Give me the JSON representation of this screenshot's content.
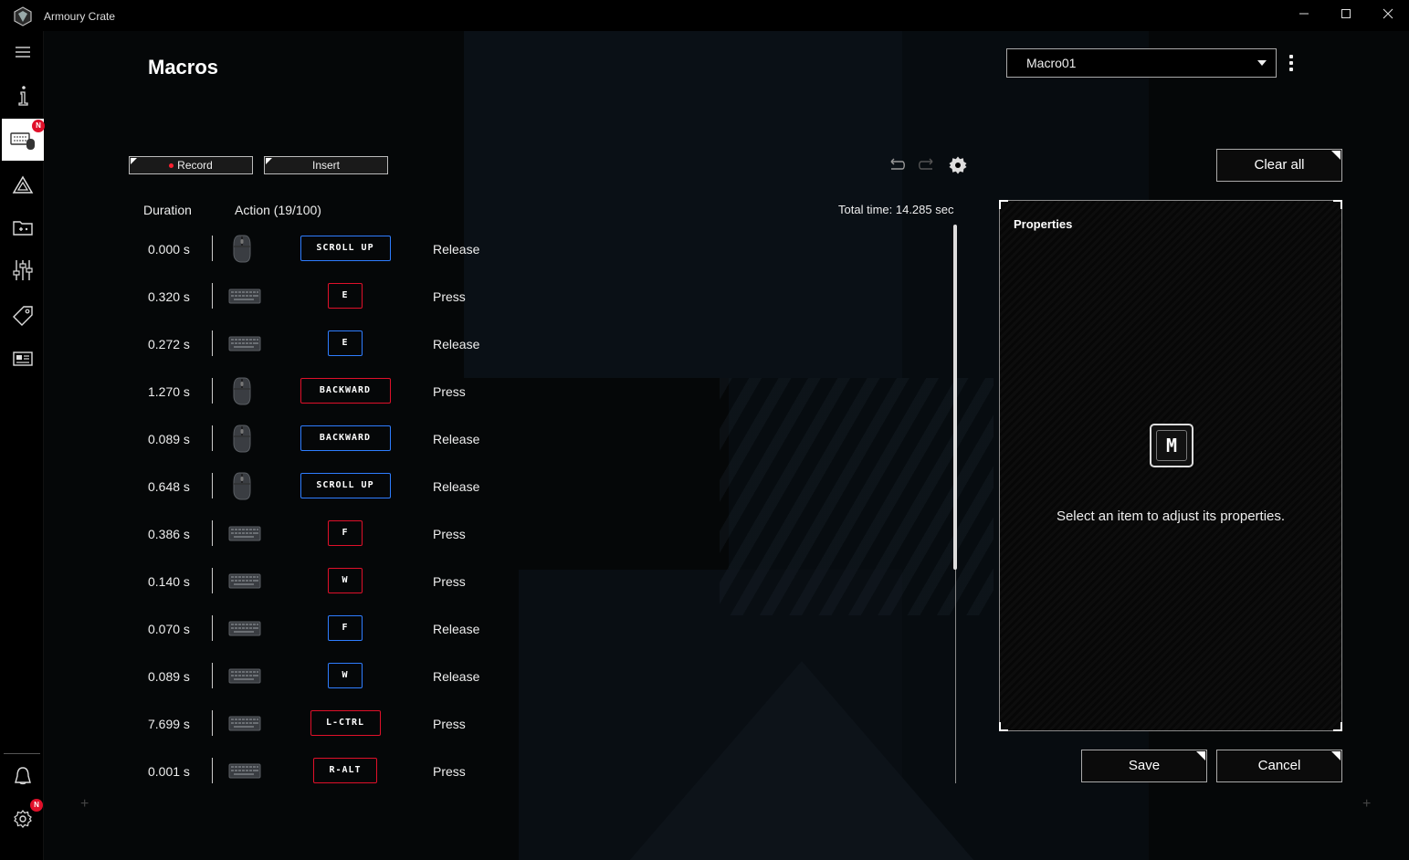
{
  "window": {
    "title": "Armoury Crate"
  },
  "page": {
    "title": "Macros"
  },
  "toolbar": {
    "record_label": "Record",
    "insert_label": "Insert",
    "clear_all_label": "Clear all"
  },
  "macro_select": {
    "value": "Macro01"
  },
  "table": {
    "duration_header": "Duration",
    "action_header": "Action (19/100)",
    "total_time": "Total time: 14.285 sec",
    "rows": [
      {
        "duration": "0.000 s",
        "device": "mouse",
        "key": "SCROLL UP",
        "event": "Release"
      },
      {
        "duration": "0.320 s",
        "device": "keyboard",
        "key": "E",
        "event": "Press"
      },
      {
        "duration": "0.272 s",
        "device": "keyboard",
        "key": "E",
        "event": "Release"
      },
      {
        "duration": "1.270 s",
        "device": "mouse",
        "key": "BACKWARD",
        "event": "Press"
      },
      {
        "duration": "0.089 s",
        "device": "mouse",
        "key": "BACKWARD",
        "event": "Release"
      },
      {
        "duration": "0.648 s",
        "device": "mouse",
        "key": "SCROLL UP",
        "event": "Release"
      },
      {
        "duration": "0.386 s",
        "device": "keyboard",
        "key": "F",
        "event": "Press"
      },
      {
        "duration": "0.140 s",
        "device": "keyboard",
        "key": "W",
        "event": "Press"
      },
      {
        "duration": "0.070 s",
        "device": "keyboard",
        "key": "F",
        "event": "Release"
      },
      {
        "duration": "0.089 s",
        "device": "keyboard",
        "key": "W",
        "event": "Release"
      },
      {
        "duration": "7.699 s",
        "device": "keyboard",
        "key": "L-CTRL",
        "event": "Press"
      },
      {
        "duration": "0.001 s",
        "device": "keyboard",
        "key": "R-ALT",
        "event": "Press"
      }
    ]
  },
  "properties": {
    "title": "Properties",
    "icon_letter": "M",
    "message": "Select an item to adjust its properties."
  },
  "actions": {
    "save_label": "Save",
    "cancel_label": "Cancel"
  },
  "sidebar": {
    "items": [
      {
        "name": "menu-icon"
      },
      {
        "name": "info-icon"
      },
      {
        "name": "device-icon",
        "badge": "N",
        "active": true
      },
      {
        "name": "aura-icon"
      },
      {
        "name": "game-library-icon"
      },
      {
        "name": "scenario-profiles-icon"
      },
      {
        "name": "deals-icon"
      },
      {
        "name": "news-icon"
      },
      {
        "name": "user-icon"
      },
      {
        "name": "settings-icon",
        "badge": "N"
      }
    ]
  },
  "colors": {
    "press": "#e0102a",
    "release": "#2e7dff",
    "badge": "#e0102a"
  }
}
